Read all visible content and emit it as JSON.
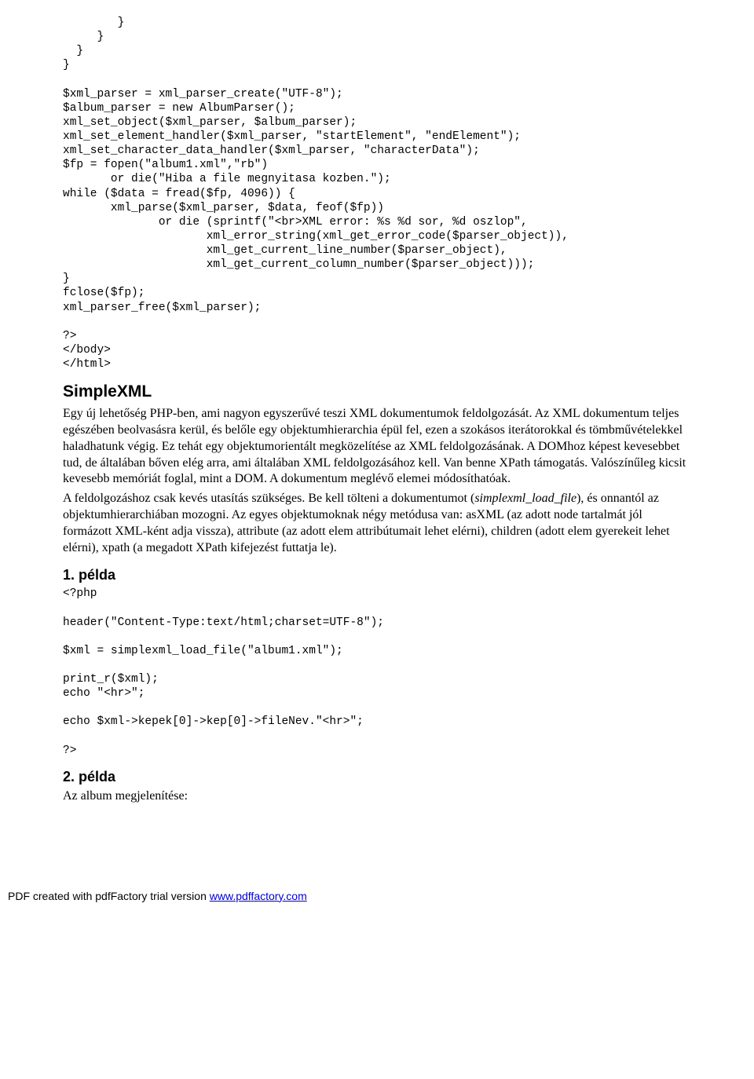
{
  "code_block_1": "        }\n     }\n  }\n}\n\n$xml_parser = xml_parser_create(\"UTF-8\");\n$album_parser = new AlbumParser();\nxml_set_object($xml_parser, $album_parser);\nxml_set_element_handler($xml_parser, \"startElement\", \"endElement\");\nxml_set_character_data_handler($xml_parser, \"characterData\");\n$fp = fopen(\"album1.xml\",\"rb\")\n       or die(\"Hiba a file megnyitasa kozben.\");\nwhile ($data = fread($fp, 4096)) {\n       xml_parse($xml_parser, $data, feof($fp))\n              or die (sprintf(\"<br>XML error: %s %d sor, %d oszlop\",\n                     xml_error_string(xml_get_error_code($parser_object)),\n                     xml_get_current_line_number($parser_object),\n                     xml_get_current_column_number($parser_object)));\n}\nfclose($fp);\nxml_parser_free($xml_parser);\n\n?>\n</body>\n</html>",
  "heading_simplexml": "SimpleXML",
  "para1": "Egy új lehetőség PHP-ben, ami nagyon egyszerűvé teszi XML dokumentumok feldolgozását. Az XML dokumentum teljes egészében beolvasásra kerül, és belőle egy objektumhierarchia épül fel, ezen a szokásos iterátorokkal és tömbművételekkel haladhatunk végig. Ez tehát egy objektumorientált megközelítése az XML feldolgozásának. A DOMhoz képest kevesebbet tud, de általában bőven elég arra, ami általában XML feldolgozásához kell. Van benne XPath támogatás. Valószínűleg kicsit kevesebb memóriát foglal, mint a DOM. A dokumentum meglévő elemei módosíthatóak.",
  "para2_pre": "A feldolgozáshoz csak kevés utasítás szükséges. Be kell tölteni a dokumentumot (",
  "para2_italic": "simplexml_load_file",
  "para2_post": "), és onnantól az objektumhierarchiában mozogni. Az egyes objektumoknak négy metódusa van: asXML (az adott node tartalmát jól formázott XML-ként adja vissza), attribute (az adott elem attribútumait lehet elérni), children (adott elem gyerekeit lehet elérni), xpath (a megadott XPath kifejezést futtatja le).",
  "heading_ex1": "1. példa",
  "code_block_2": "<?php\n\nheader(\"Content-Type:text/html;charset=UTF-8\");\n\n$xml = simplexml_load_file(\"album1.xml\");\n\nprint_r($xml);\necho \"<hr>\";\n\necho $xml->kepek[0]->kep[0]->fileNev.\"<hr>\";\n\n?>",
  "heading_ex2": "2. példa",
  "para3": "Az album megjelenítése:",
  "footer_text": "PDF created with pdfFactory trial version ",
  "footer_link": "www.pdffactory.com"
}
